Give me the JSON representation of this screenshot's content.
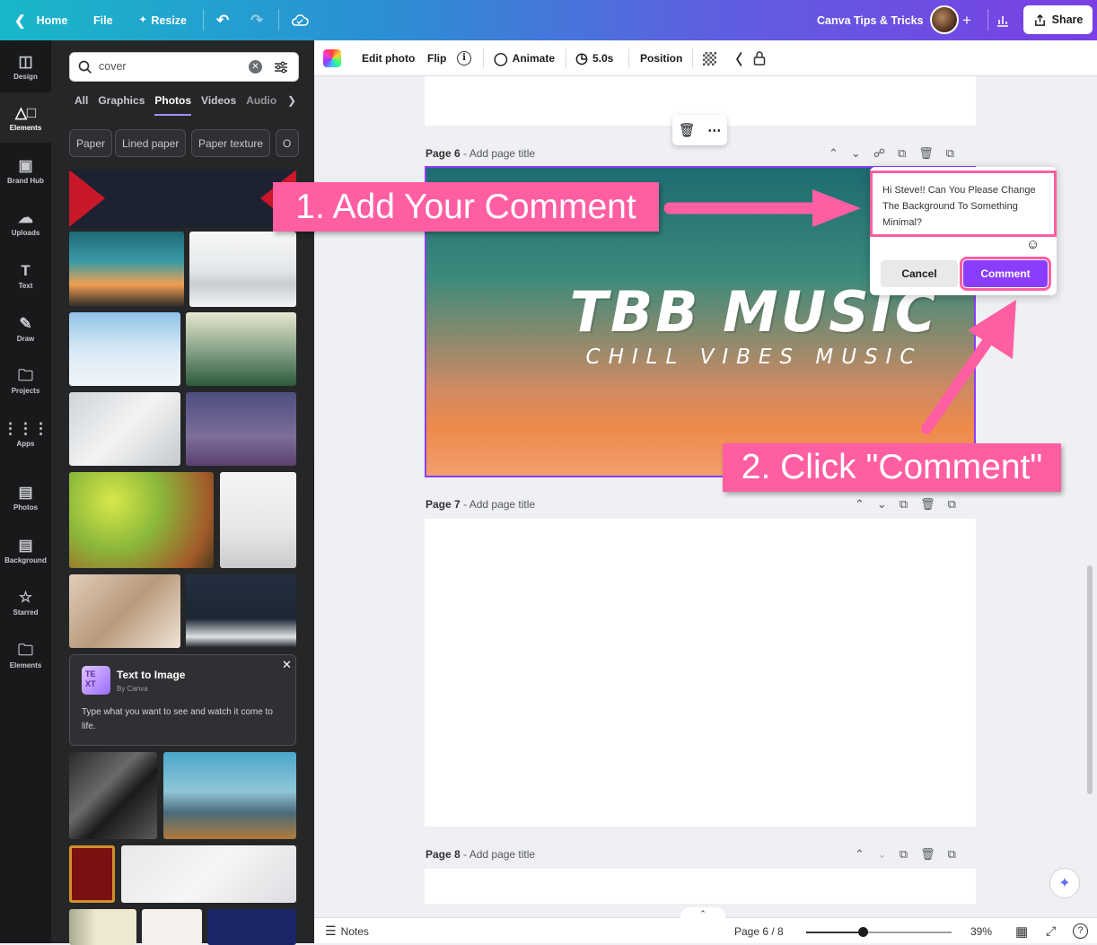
{
  "topbar": {
    "home": "Home",
    "file": "File",
    "resize": "Resize",
    "team": "Canva Tips & Tricks",
    "share": "Share"
  },
  "rail": [
    {
      "label": "Design",
      "icon": "design-icon"
    },
    {
      "label": "Elements",
      "icon": "elements-icon"
    },
    {
      "label": "Brand Hub",
      "icon": "brand-icon"
    },
    {
      "label": "Uploads",
      "icon": "upload-icon"
    },
    {
      "label": "Text",
      "icon": "text-icon"
    },
    {
      "label": "Draw",
      "icon": "draw-icon"
    },
    {
      "label": "Projects",
      "icon": "folder-icon"
    },
    {
      "label": "Apps",
      "icon": "apps-icon"
    },
    {
      "label": "Photos",
      "icon": "photos-icon"
    },
    {
      "label": "Background",
      "icon": "background-icon"
    },
    {
      "label": "Starred",
      "icon": "star-icon"
    },
    {
      "label": "Elements",
      "icon": "folder-icon"
    }
  ],
  "panel": {
    "search_value": "cover",
    "tabs": [
      "All",
      "Graphics",
      "Photos",
      "Videos",
      "Audio"
    ],
    "chips": [
      "Paper",
      "Lined paper",
      "Paper texture",
      "O"
    ],
    "tti": {
      "title": "Text to Image",
      "by": "By Canva",
      "desc": "Type what you want to see and watch it come to life."
    }
  },
  "toolbar": {
    "edit_photo": "Edit photo",
    "flip": "Flip",
    "animate": "Animate",
    "duration": "5.0s",
    "position": "Position"
  },
  "pages": {
    "p6": {
      "name": "Page 6",
      "title": "- Add page title"
    },
    "p7": {
      "name": "Page 7",
      "title": "- Add page title"
    },
    "p8": {
      "name": "Page 8",
      "title": "- Add page title"
    }
  },
  "design": {
    "title": "TBB MUSIC",
    "subtitle": "CHILL VIBES MUSIC"
  },
  "comment": {
    "text": "Hi Steve!! Can You Please Change The Background To Something Minimal?",
    "cancel": "Cancel",
    "submit": "Comment"
  },
  "callouts": {
    "one": "1. Add Your Comment",
    "two": "2. Click \"Comment\""
  },
  "bottombar": {
    "notes": "Notes",
    "page": "Page 6 / 8",
    "zoom": "39%",
    "zoom_level": 0.39
  },
  "colors": {
    "accent": "#8b3dff",
    "callout": "#ff5fa2"
  }
}
